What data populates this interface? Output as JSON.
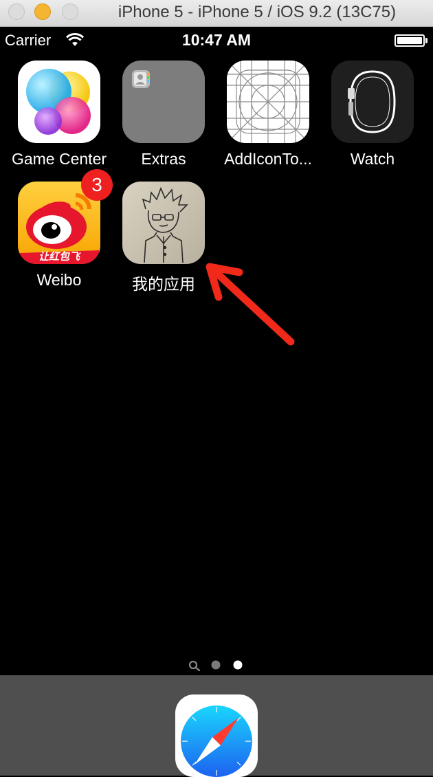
{
  "window": {
    "title": "iPhone 5 - iPhone 5 / iOS 9.2 (13C75)"
  },
  "status_bar": {
    "carrier": "Carrier",
    "time": "10:47 AM",
    "wifi_icon": "wifi-icon",
    "battery_icon": "battery-icon"
  },
  "apps": [
    {
      "label": "Game Center",
      "icon": "game-center-icon"
    },
    {
      "label": "Extras",
      "icon": "folder-icon"
    },
    {
      "label": "AddIconTo...",
      "icon": "icon-template-icon"
    },
    {
      "label": "Watch",
      "icon": "watch-icon"
    },
    {
      "label": "Weibo",
      "icon": "weibo-icon",
      "badge": "3"
    },
    {
      "label": "我的应用",
      "icon": "cartoon-avatar-icon"
    }
  ],
  "weibo_banner_text": "让红包飞",
  "page_indicator": {
    "pages": 3,
    "current": 3,
    "first_page_icon": "search-icon"
  },
  "dock": {
    "apps": [
      {
        "icon": "safari-compass-icon"
      }
    ]
  },
  "annotation": {
    "icon": "red-arrow-icon",
    "color": "#f0291b"
  }
}
